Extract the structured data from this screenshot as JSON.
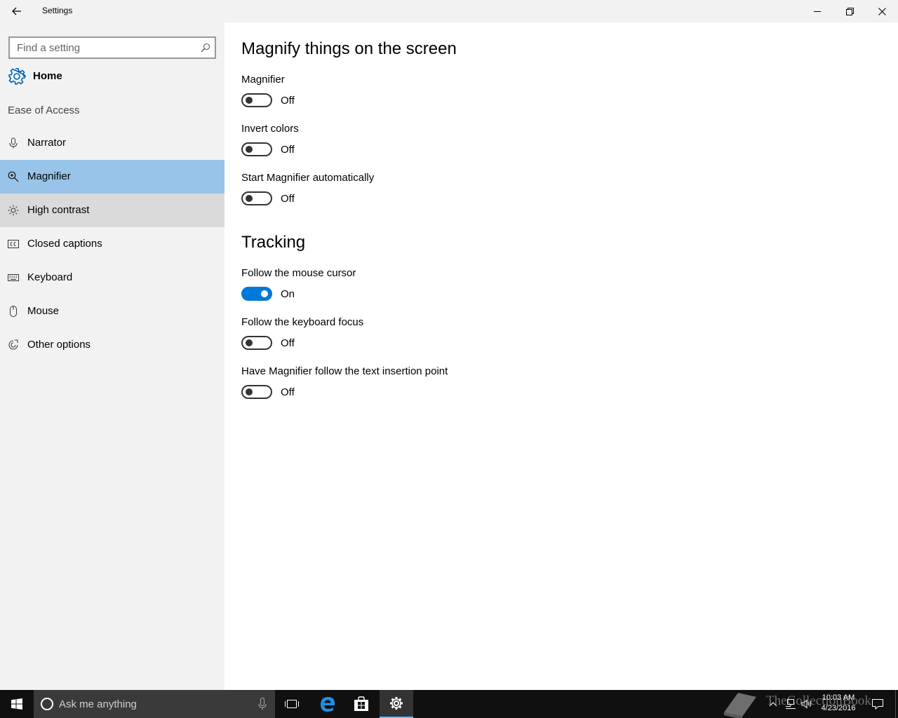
{
  "window": {
    "title": "Settings",
    "back_icon": "back-arrow-icon",
    "minimize_icon": "minimize-icon",
    "restore_icon": "restore-icon",
    "close_icon": "close-icon"
  },
  "sidebar": {
    "search_placeholder": "Find a setting",
    "home_label": "Home",
    "section_title": "Ease of Access",
    "items": [
      {
        "label": "Narrator",
        "icon": "microphone-icon"
      },
      {
        "label": "Magnifier",
        "icon": "magnifier-icon"
      },
      {
        "label": "High contrast",
        "icon": "sun-icon"
      },
      {
        "label": "Closed captions",
        "icon": "closed-captions-icon"
      },
      {
        "label": "Keyboard",
        "icon": "keyboard-icon"
      },
      {
        "label": "Mouse",
        "icon": "mouse-icon"
      },
      {
        "label": "Other options",
        "icon": "other-options-icon"
      }
    ],
    "selected_item": "Magnifier",
    "selected_color": "#99c4e9"
  },
  "content": {
    "heading": "Magnify things on the screen",
    "settings": [
      {
        "label": "Magnifier",
        "state": "Off"
      },
      {
        "label": "Invert colors",
        "state": "Off"
      },
      {
        "label": "Start Magnifier automatically",
        "state": "Off"
      }
    ],
    "tracking_heading": "Tracking",
    "tracking": [
      {
        "label": "Follow the mouse cursor",
        "state": "On"
      },
      {
        "label": "Follow the keyboard focus",
        "state": "Off"
      },
      {
        "label": "Have Magnifier follow the text insertion point",
        "state": "Off"
      }
    ],
    "accent_color": "#0078d7"
  },
  "taskbar": {
    "cortana_text": "Ask me anything",
    "time": "10:03 AM",
    "date": "4/23/2016",
    "watermark": "TheCollectionBook"
  }
}
